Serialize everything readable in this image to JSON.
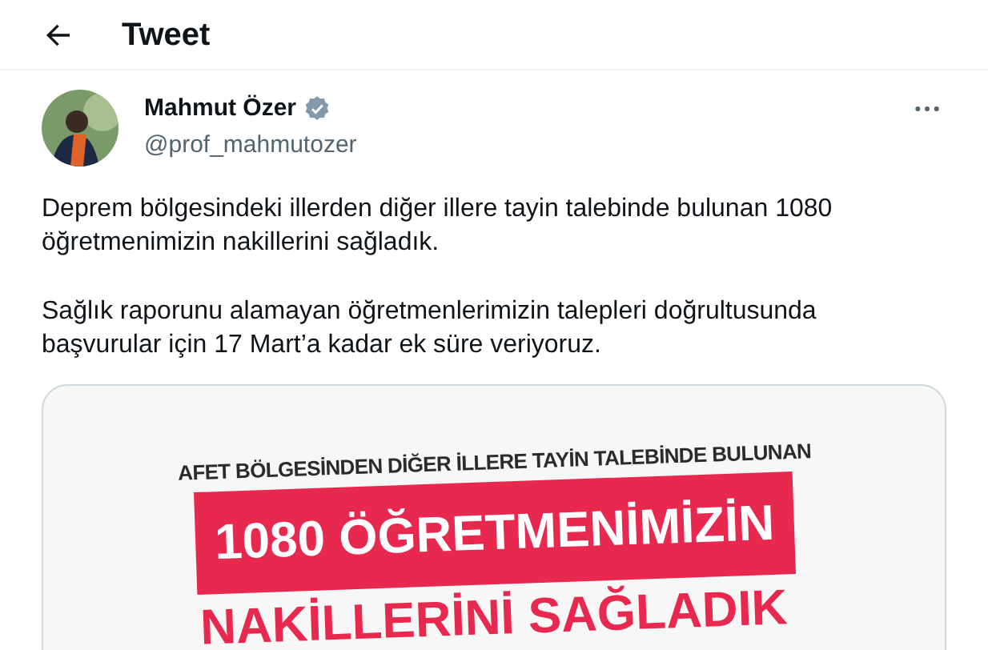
{
  "header": {
    "title": "Tweet"
  },
  "author": {
    "name": "Mahmut Özer",
    "verified": true,
    "handle": "@prof_mahmutozer"
  },
  "paragraphs": [
    "Deprem bölgesindeki illerden diğer illere tayin talebinde bulunan 1080 öğretmenimizin nakillerini sağladık.",
    "Sağlık raporunu alamayan öğretmenlerimizin talepleri doğrultusunda başvurular için 17 Mart’a kadar ek süre veriyoruz."
  ],
  "media": {
    "lines": [
      {
        "kind": "subtitle",
        "text": "AFET BÖLGESİNDEN DİĞER İLLERE TAYİN TALEBİNDE BULUNAN"
      },
      {
        "kind": "banner",
        "text": "1080 ÖĞRETMENİMİZİN"
      },
      {
        "kind": "headline",
        "text": "NAKİLLERİNİ SAĞLADIK"
      }
    ]
  }
}
